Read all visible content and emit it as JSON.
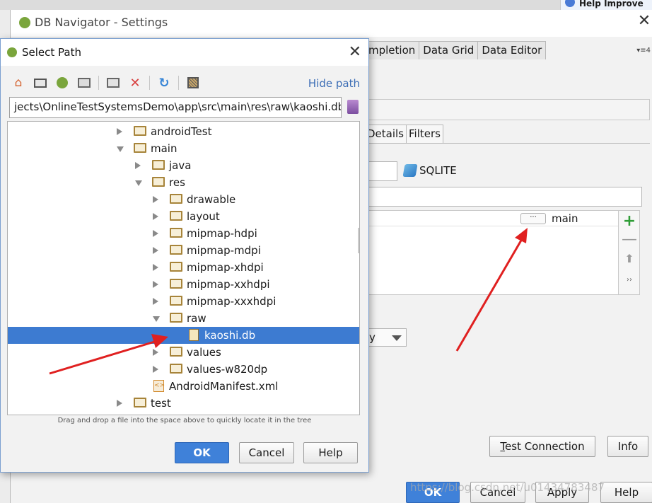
{
  "background": {
    "help_improve_text": "Help Improve"
  },
  "settings": {
    "title": "DB Navigator - Settings",
    "tabs": [
      "mpletion",
      "Data Grid",
      "Data Editor"
    ],
    "overflow_label": "▾≡4",
    "inner_tabs": [
      "Details",
      "Filters"
    ],
    "db_type": "SQLITE",
    "path_table": {
      "ellipsis": "···",
      "value": "main"
    },
    "dropdown_value": "y",
    "buttons": {
      "test_connection_prefix": "T",
      "test_connection_rest": "est Connection",
      "info": "Info",
      "ok": "OK",
      "cancel": "Cancel",
      "apply": "Apply",
      "help": "Help"
    }
  },
  "dialog": {
    "title": "Select Path",
    "hide_path": "Hide path",
    "path": "jects\\OnlineTestSystemsDemo\\app\\src\\main\\res\\raw\\kaoshi.db",
    "tree": [
      {
        "label": "androidTest",
        "level": 1,
        "state": "collapsed",
        "kind": "folder"
      },
      {
        "label": "main",
        "level": 1,
        "state": "expanded",
        "kind": "folder"
      },
      {
        "label": "java",
        "level": 2,
        "state": "collapsed",
        "kind": "folder"
      },
      {
        "label": "res",
        "level": 2,
        "state": "expanded",
        "kind": "folder"
      },
      {
        "label": "drawable",
        "level": 3,
        "state": "collapsed",
        "kind": "folder"
      },
      {
        "label": "layout",
        "level": 3,
        "state": "collapsed",
        "kind": "folder"
      },
      {
        "label": "mipmap-hdpi",
        "level": 3,
        "state": "collapsed",
        "kind": "folder"
      },
      {
        "label": "mipmap-mdpi",
        "level": 3,
        "state": "collapsed",
        "kind": "folder"
      },
      {
        "label": "mipmap-xhdpi",
        "level": 3,
        "state": "collapsed",
        "kind": "folder"
      },
      {
        "label": "mipmap-xxhdpi",
        "level": 3,
        "state": "collapsed",
        "kind": "folder"
      },
      {
        "label": "mipmap-xxxhdpi",
        "level": 3,
        "state": "collapsed",
        "kind": "folder"
      },
      {
        "label": "raw",
        "level": 3,
        "state": "expanded",
        "kind": "folder"
      },
      {
        "label": "kaoshi.db",
        "level": 4,
        "state": "leaf",
        "kind": "db",
        "selected": true
      },
      {
        "label": "values",
        "level": 3,
        "state": "collapsed",
        "kind": "folder"
      },
      {
        "label": "values-w820dp",
        "level": 3,
        "state": "collapsed",
        "kind": "folder"
      },
      {
        "label": "AndroidManifest.xml",
        "level": 2,
        "state": "leaf",
        "kind": "xml"
      },
      {
        "label": "test",
        "level": 1,
        "state": "collapsed",
        "kind": "folder"
      }
    ],
    "hint": "Drag and drop a file into the space above to quickly locate it in the tree",
    "buttons": {
      "ok": "OK",
      "cancel": "Cancel",
      "help": "Help"
    },
    "icons": [
      "home-icon",
      "desktop-icon",
      "android-project-icon",
      "module-icon",
      "new-folder-icon",
      "delete-icon",
      "refresh-icon",
      "show-hidden-icon"
    ]
  },
  "watermark": "https://blog.csdn.net/u01434783487",
  "colors": {
    "accent_blue": "#3d7bd1",
    "arrow_red": "#e02020",
    "add_green": "#2f9d36"
  }
}
